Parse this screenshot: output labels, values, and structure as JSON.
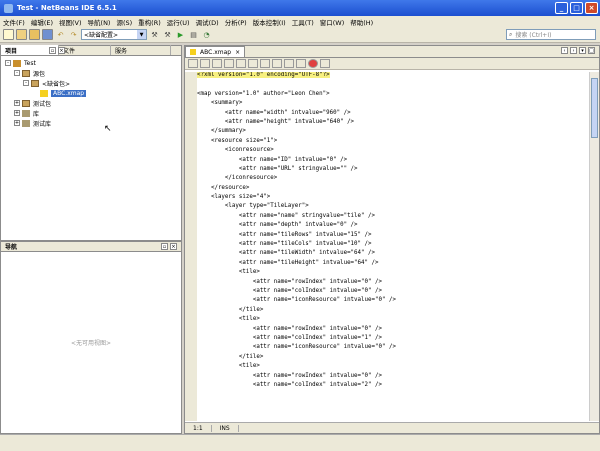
{
  "window": {
    "title": "Test - NetBeans IDE 6.5.1",
    "minimize": "_",
    "maximize": "□",
    "close": "×"
  },
  "menu": [
    "文件(F)",
    "编辑(E)",
    "视图(V)",
    "导航(N)",
    "源(S)",
    "重构(R)",
    "运行(U)",
    "调试(D)",
    "分析(P)",
    "版本控制(I)",
    "工具(T)",
    "窗口(W)",
    "帮助(H)"
  ],
  "toolbar": {
    "config_value": "<缺省配置>",
    "search_placeholder": "搜索 (Ctrl+I)"
  },
  "left_panel": {
    "tabs": [
      "项目",
      "文件",
      "服务"
    ],
    "tree": [
      {
        "label": "Test",
        "depth": 0,
        "toggle": "-",
        "icon": "project-icon"
      },
      {
        "label": "源包",
        "depth": 1,
        "toggle": "-",
        "icon": "package-folder-icon"
      },
      {
        "label": "<缺省包>",
        "depth": 2,
        "toggle": "-",
        "icon": "package-icon"
      },
      {
        "label": "ABC.xmap",
        "depth": 3,
        "toggle": "",
        "icon": "file-icon",
        "selected": true
      },
      {
        "label": "测试包",
        "depth": 1,
        "toggle": "+",
        "icon": "package-folder-icon"
      },
      {
        "label": "库",
        "depth": 1,
        "toggle": "+",
        "icon": "library-icon"
      },
      {
        "label": "测试库",
        "depth": 1,
        "toggle": "+",
        "icon": "library-icon"
      }
    ]
  },
  "nav_panel": {
    "title": "导航",
    "empty_text": "<无可用视图>"
  },
  "editor": {
    "tab_label": "ABC.xmap",
    "code": [
      "<?xml version=\"1.0\" encoding=\"UTF-8\"?>",
      "",
      "<map version=\"1.0\" author=\"Leon Chen\">",
      "    <summary>",
      "        <attr name=\"width\" intvalue=\"960\" />",
      "        <attr name=\"height\" intvalue=\"640\" />",
      "    </summary>",
      "    <resource size=\"1\">",
      "        <iconresource>",
      "            <attr name=\"ID\" intvalue=\"0\" />",
      "            <attr name=\"URL\" stringvalue=\"\" />",
      "        </iconresource>",
      "    </resource>",
      "    <layers size=\"4\">",
      "        <layer type=\"TileLayer\">",
      "            <attr name=\"name\" stringvalue=\"tile\" />",
      "            <attr name=\"depth\" intvalue=\"0\" />",
      "            <attr name=\"tileRows\" intvalue=\"15\" />",
      "            <attr name=\"tileCols\" intvalue=\"10\" />",
      "            <attr name=\"tileWidth\" intvalue=\"64\" />",
      "            <attr name=\"tileHeight\" intvalue=\"64\" />",
      "            <tile>",
      "                <attr name=\"rowIndex\" intvalue=\"0\" />",
      "                <attr name=\"colIndex\" intvalue=\"0\" />",
      "                <attr name=\"iconResource\" intvalue=\"0\" />",
      "            </tile>",
      "            <tile>",
      "                <attr name=\"rowIndex\" intvalue=\"0\" />",
      "                <attr name=\"colIndex\" intvalue=\"1\" />",
      "                <attr name=\"iconResource\" intvalue=\"0\" />",
      "            </tile>",
      "            <tile>",
      "                <attr name=\"rowIndex\" intvalue=\"0\" />",
      "                <attr name=\"colIndex\" intvalue=\"2\" />"
    ],
    "status_position": "1:1",
    "status_mode": "INS"
  }
}
